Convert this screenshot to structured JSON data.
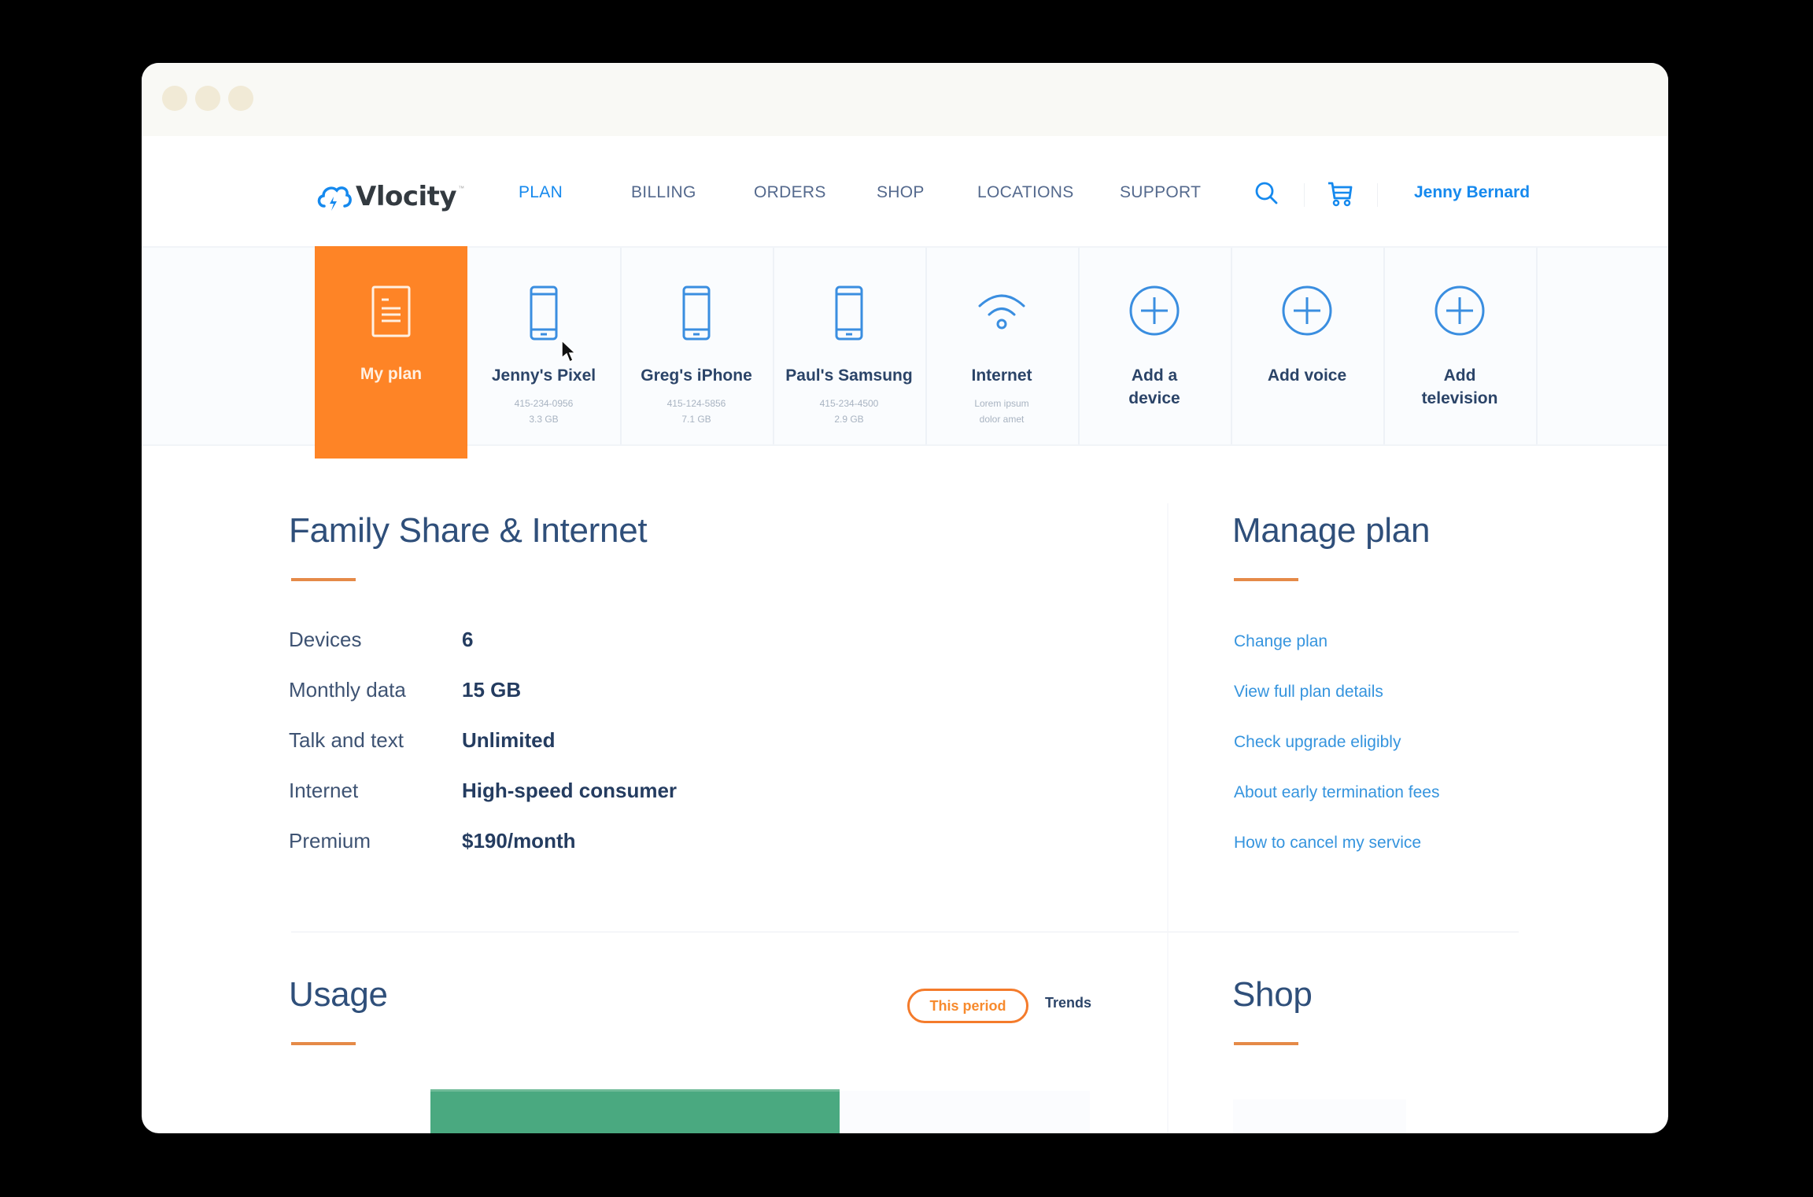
{
  "window": {
    "controls": [
      "close",
      "minimize",
      "maximize"
    ]
  },
  "header": {
    "logo": {
      "icon": "cloud-bolt-icon",
      "text": "Vlocity",
      "tm": "™"
    },
    "nav": [
      {
        "label": "PLAN",
        "active": true
      },
      {
        "label": "BILLING",
        "active": false
      },
      {
        "label": "ORDERS",
        "active": false
      },
      {
        "label": "SHOP",
        "active": false
      },
      {
        "label": "LOCATIONS",
        "active": false
      },
      {
        "label": "SUPPORT",
        "active": false
      }
    ],
    "search_icon": "search-icon",
    "cart_icon": "cart-icon",
    "user_name": "Jenny Bernard"
  },
  "devices": [
    {
      "name": "My plan",
      "icon": "document-icon",
      "line1": "",
      "line2": "",
      "active": true
    },
    {
      "name": "Jenny's Pixel",
      "icon": "phone-icon",
      "line1": "415-234-0956",
      "line2": "3.3 GB",
      "active": false
    },
    {
      "name": "Greg's iPhone",
      "icon": "phone-icon",
      "line1": "415-124-5856",
      "line2": "7.1 GB",
      "active": false
    },
    {
      "name": "Paul's Samsung",
      "icon": "phone-icon",
      "line1": "415-234-4500",
      "line2": "2.9 GB",
      "active": false
    },
    {
      "name": "Internet",
      "icon": "wifi-icon",
      "line1": "Lorem ipsum",
      "line2": "dolor amet",
      "active": false
    },
    {
      "name": "Add a device",
      "icon": "plus-circle-icon",
      "line1": "",
      "line2": "",
      "active": false
    },
    {
      "name": "Add voice",
      "icon": "plus-circle-icon",
      "line1": "",
      "line2": "",
      "active": false
    },
    {
      "name": "Add television",
      "icon": "plus-circle-icon",
      "line1": "",
      "line2": "",
      "active": false
    }
  ],
  "plan": {
    "title": "Family Share & Internet",
    "rows": [
      {
        "label": "Devices",
        "value": "6"
      },
      {
        "label": "Monthly data",
        "value": "15 GB"
      },
      {
        "label": "Talk and text",
        "value": "Unlimited"
      },
      {
        "label": "Internet",
        "value": "High-speed consumer"
      },
      {
        "label": "Premium",
        "value": "$190/month"
      }
    ]
  },
  "manage": {
    "title": "Manage plan",
    "links": [
      "Change plan",
      "View full plan details",
      "Check upgrade eligibly",
      "About early termination fees",
      "How to cancel my service"
    ]
  },
  "usage": {
    "title": "Usage",
    "toggle": [
      {
        "label": "This period",
        "active": true
      },
      {
        "label": "Trends",
        "active": false
      }
    ],
    "bar_fill_fraction": 0.62
  },
  "shop": {
    "title": "Shop"
  },
  "colors": {
    "accent_orange": "#fe8426",
    "brand_blue": "#1589ee",
    "nav_underline": "#0070d2",
    "usage_green": "#4aa980",
    "heading_navy": "#2f4f7a"
  }
}
